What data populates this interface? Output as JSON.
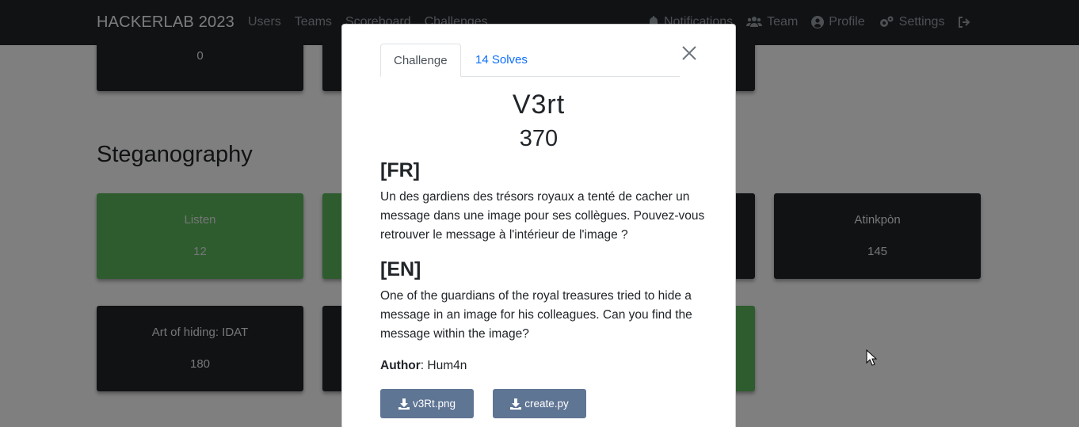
{
  "navbar": {
    "brand": "HACKERLAB 2023",
    "left_links": [
      "Users",
      "Teams",
      "Scoreboard",
      "Challenges"
    ],
    "right_links": [
      {
        "label": "Notifications",
        "icon": "bell-icon"
      },
      {
        "label": "Team",
        "icon": "users-icon"
      },
      {
        "label": "Profile",
        "icon": "user-circle-icon"
      },
      {
        "label": "Settings",
        "icon": "cogs-icon"
      },
      {
        "label": "",
        "icon": "logout-icon"
      }
    ]
  },
  "background": {
    "top_cards": [
      {
        "name": "",
        "value": "0"
      },
      {
        "name": "",
        "value": ""
      }
    ],
    "section_title": "Steganography",
    "cards_row1": [
      {
        "name": "Listen",
        "value": "12",
        "solved": true
      },
      {
        "name": "Atinkpòn",
        "value": "145",
        "solved": false
      }
    ],
    "cards_row2": [
      {
        "name": "Art of hiding: IDAT",
        "value": "180",
        "solved": false
      }
    ]
  },
  "modal": {
    "tabs": [
      "Challenge",
      "14 Solves"
    ],
    "challenge_name": "V3rt",
    "challenge_value": "370",
    "fr_heading": "[FR]",
    "fr_text": "Un des gardiens des trésors royaux a tenté de cacher un message dans une image pour ses collègues. Pouvez-vous retrouver le message à l'intérieur de l'image ?",
    "en_heading": "[EN]",
    "en_text": "One of the guardians of the royal treasures tried to hide a message in an image for his colleagues. Can you find the message within the image?",
    "author_label": "Author",
    "author_value": ": Hum4n",
    "files": [
      "v3Rt.png",
      "create.py"
    ]
  },
  "colors": {
    "navbar": "#212529",
    "solved": "#5cb85c",
    "link": "#0d6efd",
    "button": "#5f7594"
  }
}
